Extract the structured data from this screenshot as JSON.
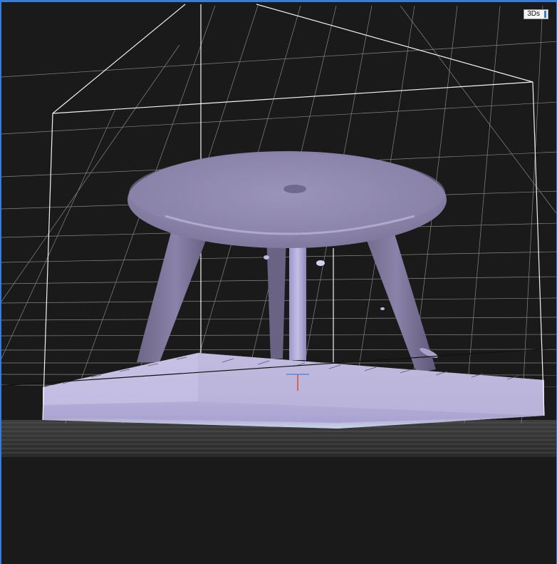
{
  "viewport": {
    "view_mode_label": "3Ds",
    "colors": {
      "background": "#1b1a1b",
      "frame": "#3a7bd5",
      "grid_line": "#e6e6e6",
      "bounding_box": "#f2f2f2",
      "model": "#8f87b4",
      "base_plate": "#b9b3d8",
      "axis_red": "#e0463a",
      "axis_blue": "#4a7fe0"
    },
    "icons": [
      "view-mode-handle-icon",
      "origin-axis-icon"
    ]
  }
}
